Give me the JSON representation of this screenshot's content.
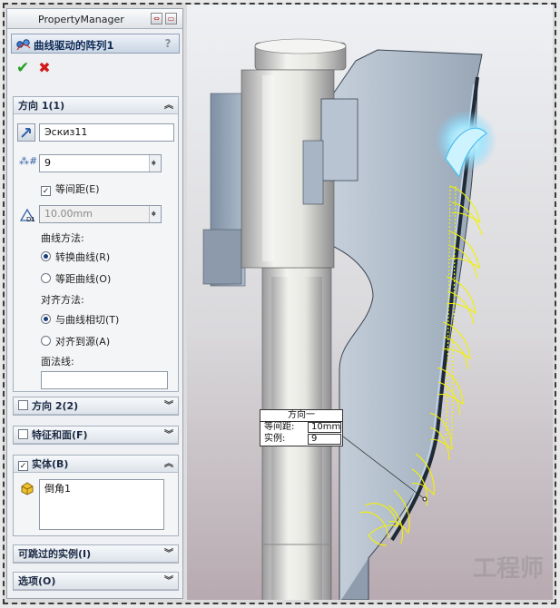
{
  "panel": {
    "tab_title": "PropertyManager",
    "feature_title": "曲线驱动的阵列1",
    "help": "?"
  },
  "direction1": {
    "title": "方向 1(1)",
    "curve_field": "Эскиз11",
    "instance_count": "9",
    "equal_spacing_label": "等间距(E)",
    "equal_spacing_checked": true,
    "spacing_value": "10.00mm",
    "curve_method_label": "曲线方法:",
    "curve_method_options": [
      "转换曲线(R)",
      "等距曲线(O)"
    ],
    "curve_method_selected": 0,
    "align_method_label": "对齐方法:",
    "align_method_options": [
      "与曲线相切(T)",
      "对齐到源(A)"
    ],
    "align_method_selected": 0,
    "face_normal_label": "面法线:",
    "face_normal_value": ""
  },
  "direction2": {
    "title": "方向 2(2)"
  },
  "features_faces": {
    "title": "特征和面(F)"
  },
  "bodies": {
    "title": "实体(B)",
    "items": [
      "倒角1"
    ]
  },
  "skip_instances": {
    "title": "可跳过的实例(I)"
  },
  "options": {
    "title": "选项(O)"
  },
  "viewport": {
    "callout_title": "方向一",
    "callout_spacing_label": "等间距:",
    "callout_spacing_value": "10mm",
    "callout_count_label": "实例:",
    "callout_count_value": "9",
    "watermark": "工程师"
  }
}
